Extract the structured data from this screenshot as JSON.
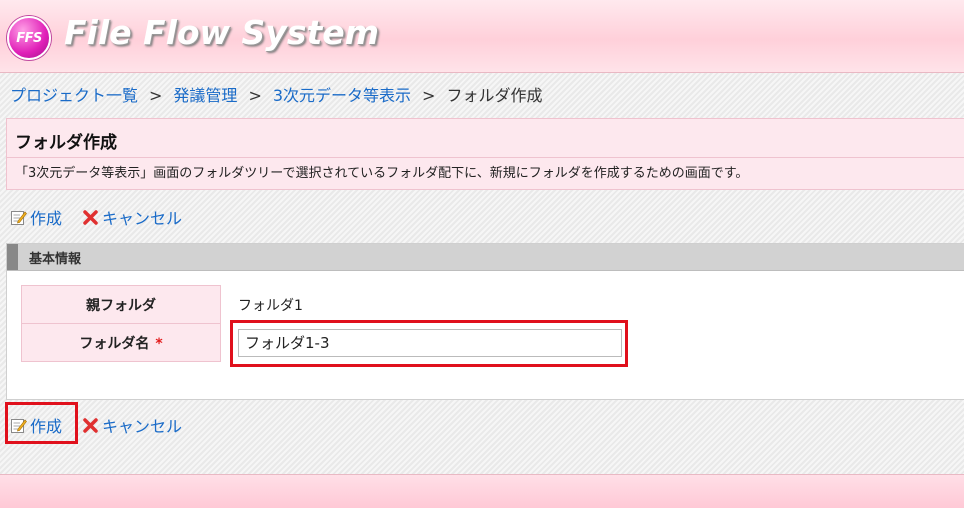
{
  "header": {
    "logo_badge": "FFS",
    "app_title": "File Flow System"
  },
  "breadcrumb": {
    "items": [
      "プロジェクト一覧",
      "発議管理",
      "3次元データ等表示"
    ],
    "current": "フォルダ作成",
    "separator": ">"
  },
  "page": {
    "title": "フォルダ作成",
    "description": "「3次元データ等表示」画面のフォルダツリーで選択されているフォルダ配下に、新規にフォルダを作成するための画面です。"
  },
  "actions": {
    "create_label": "作成",
    "cancel_label": "キャンセル"
  },
  "section": {
    "title": "基本情報",
    "parent_folder_label": "親フォルダ",
    "parent_folder_value": "フォルダ1",
    "folder_name_label": "フォルダ名",
    "required_mark": "*",
    "folder_name_value": "フォルダ1-3"
  },
  "icons": {
    "create": "edit-note-icon",
    "cancel": "red-x-icon"
  },
  "colors": {
    "link": "#1a6bc8",
    "highlight": "#e0101c",
    "header_pink": "#ffd0da",
    "required": "#e21a1a"
  }
}
